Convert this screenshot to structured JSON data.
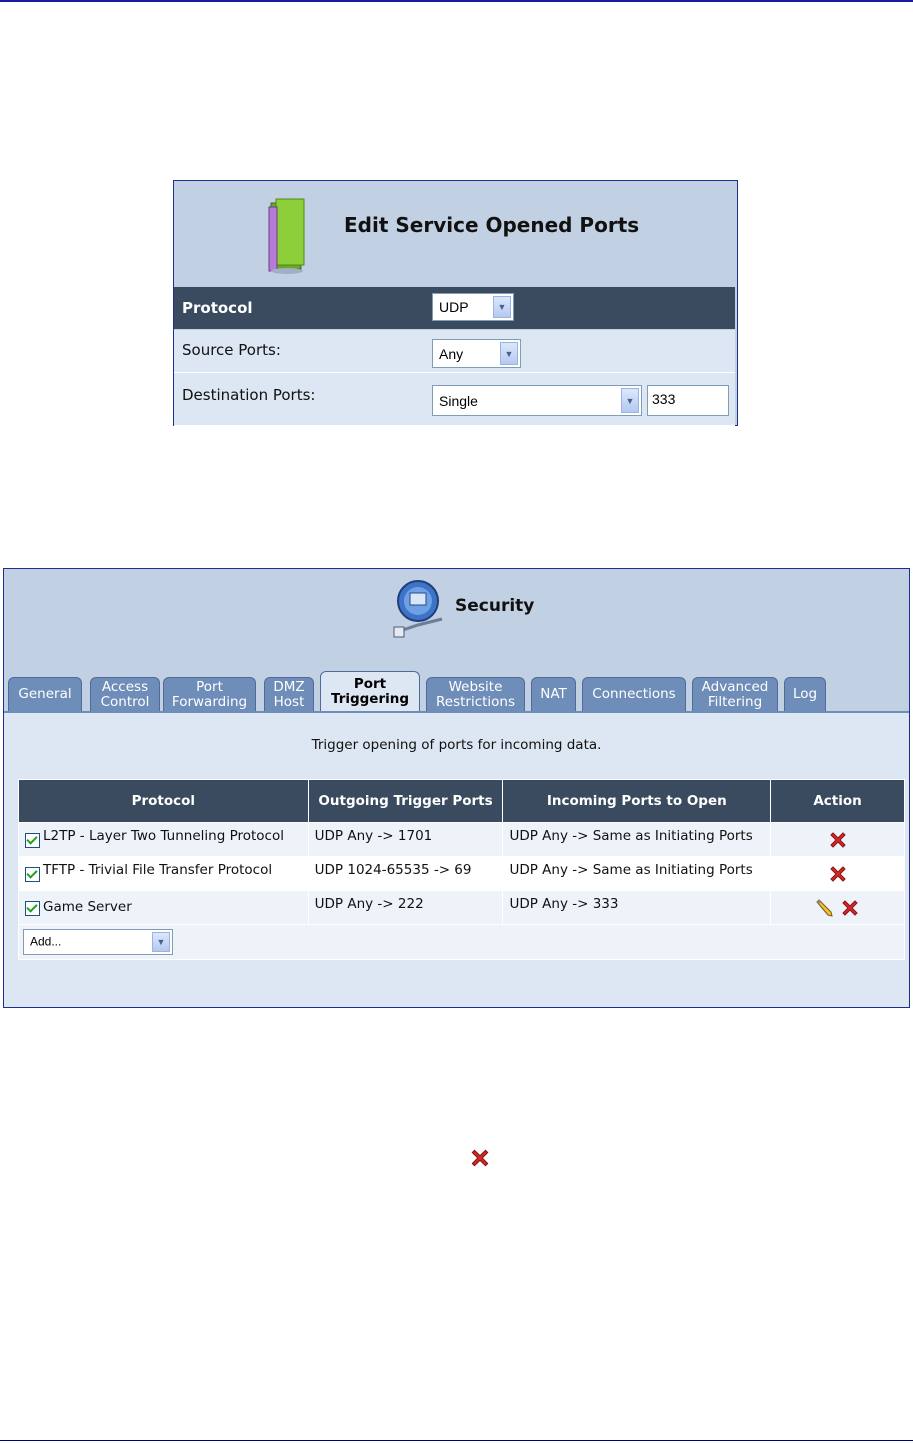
{
  "edit_panel": {
    "title": "Edit Service Opened Ports",
    "protocol_label": "Protocol",
    "protocol_value": "UDP",
    "source_ports_label": "Source Ports:",
    "source_ports_value": "Any",
    "destination_ports_label": "Destination Ports:",
    "destination_ports_mode": "Single",
    "destination_ports_value": "333"
  },
  "security_panel": {
    "title": "Security",
    "tabs": [
      {
        "line1": "General",
        "line2": ""
      },
      {
        "line1": "Access",
        "line2": "Control"
      },
      {
        "line1": "Port",
        "line2": "Forwarding"
      },
      {
        "line1": "DMZ",
        "line2": "Host"
      },
      {
        "line1": "Port",
        "line2": "Triggering"
      },
      {
        "line1": "Website",
        "line2": "Restrictions"
      },
      {
        "line1": "NAT",
        "line2": ""
      },
      {
        "line1": "Connections",
        "line2": ""
      },
      {
        "line1": "Advanced",
        "line2": "Filtering"
      },
      {
        "line1": "Log",
        "line2": ""
      }
    ],
    "active_tab": "Port Triggering",
    "description": "Trigger opening of ports for incoming data.",
    "columns": {
      "protocol": "Protocol",
      "outgoing": "Outgoing Trigger Ports",
      "incoming": "Incoming Ports to Open",
      "action": "Action"
    },
    "rows": [
      {
        "checked": true,
        "protocol": "L2TP - Layer Two Tunneling Protocol",
        "outgoing": "UDP Any -> 1701",
        "incoming": "UDP Any -> Same as Initiating Ports",
        "actions": [
          "delete"
        ]
      },
      {
        "checked": true,
        "protocol": "TFTP - Trivial File Transfer Protocol",
        "outgoing": "UDP 1024-65535 -> 69",
        "incoming": "UDP Any -> Same as Initiating Ports",
        "actions": [
          "delete"
        ]
      },
      {
        "checked": true,
        "protocol": "Game Server",
        "outgoing": "UDP Any -> 222",
        "incoming": "UDP Any -> 333",
        "actions": [
          "edit",
          "delete"
        ]
      }
    ],
    "add_select": "Add..."
  },
  "icons": {
    "edit_panel_icon": "book-icon",
    "security_icon": "globe-shield-icon",
    "delete_icon": "delete-x-icon",
    "edit_icon": "pencil-icon",
    "check_color": "#21a121",
    "delete_color": "#d32a2a"
  }
}
